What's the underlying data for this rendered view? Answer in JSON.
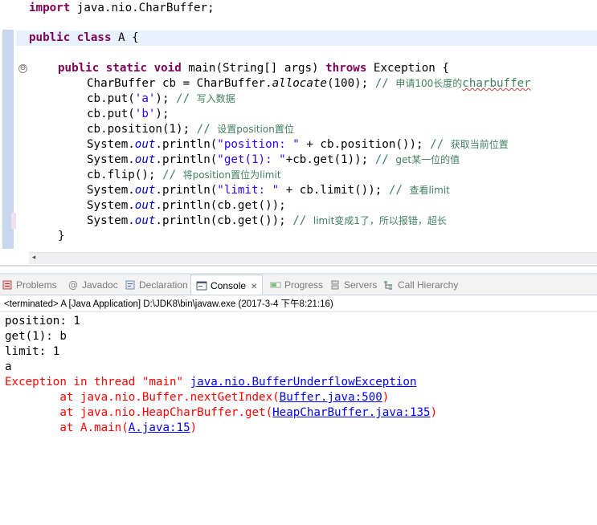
{
  "editor": {
    "line_import_kw": "import",
    "line_import_rest": " java.nio.CharBuffer;",
    "class_kw": "public class",
    "class_rest": " A {",
    "main_kw1": "public static void",
    "main_rest1": " main(String[] args) ",
    "main_kw2": "throws",
    "main_rest2": " Exception {",
    "l1_code": "CharBuffer cb = CharBuffer.",
    "l1_static": "allocate",
    "l1_tail": "(100); ",
    "l1_cm_a": "// ",
    "l1_cm_b": "申请100长度的",
    "l1_cm_c": "charbuffer",
    "l2_code": "cb.put(",
    "l2_str": "'a'",
    "l2_tail": "); ",
    "l2_cm": "// ",
    "l2_cm_cjk": "写入数据",
    "l3_code": "cb.put(",
    "l3_str": "'b'",
    "l3_tail": ");",
    "l4_code": "cb.position(1); ",
    "l4_cm": "// ",
    "l4_cm_cjk": "设置position置位",
    "l5_a": "System.",
    "l5_field": "out",
    "l5_b": ".println(",
    "l5_str": "\"position: \"",
    "l5_c": " + cb.position()); ",
    "l5_cm": "// ",
    "l5_cm_cjk": "获取当前位置",
    "l6_a": "System.",
    "l6_field": "out",
    "l6_b": ".println(",
    "l6_str": "\"get(1): \"",
    "l6_c": "+cb.get(1)); ",
    "l6_cm": "// ",
    "l6_cm_cjk": "get某一位的值",
    "l7_code": "cb.flip(); ",
    "l7_cm": "// ",
    "l7_cm_cjk": "将position置位为limit",
    "l8_a": "System.",
    "l8_field": "out",
    "l8_b": ".println(",
    "l8_str": "\"limit: \"",
    "l8_c": " + cb.limit()); ",
    "l8_cm": "// ",
    "l8_cm_cjk": "查看limit",
    "l9_a": "System.",
    "l9_field": "out",
    "l9_b": ".println(cb.get());",
    "l10_a": "System.",
    "l10_field": "out",
    "l10_b": ".println(cb.get()); ",
    "l10_cm": "// ",
    "l10_cm_cjk": "limit变成1了，所以报错，超长",
    "close_main": "}",
    "fold_symbol": "⊖",
    "scroll_left_symbol": "◂"
  },
  "views": {
    "tabs": [
      {
        "label": "Problems",
        "icon": "problems-icon"
      },
      {
        "label": "Javadoc",
        "icon": "javadoc-icon"
      },
      {
        "label": "Declaration",
        "icon": "declaration-icon"
      },
      {
        "label": "Console",
        "icon": "console-icon",
        "active": true
      },
      {
        "label": "Progress",
        "icon": "progress-icon"
      },
      {
        "label": "Servers",
        "icon": "servers-icon"
      },
      {
        "label": "Call Hierarchy",
        "icon": "call-hierarchy-icon"
      }
    ],
    "close_symbol": "✕"
  },
  "console": {
    "header": "<terminated> A [Java Application] D:\\JDK8\\bin\\javaw.exe (2017-3-4 下午8:21:16)",
    "out1": "position: 1",
    "out2": "get(1): b",
    "out3": "limit: 1",
    "out4": "a",
    "exc_prefix": "Exception in thread \"main\" ",
    "exc_link": "java.nio.BufferUnderflowException",
    "st1_prefix": "        at java.nio.Buffer.nextGetIndex(",
    "st1_link": "Buffer.java:500",
    "st1_suffix": ")",
    "st2_prefix": "        at java.nio.HeapCharBuffer.get(",
    "st2_link": "HeapCharBuffer.java:135",
    "st2_suffix": ")",
    "st3_prefix": "        at A.main(",
    "st3_link": "A.java:15",
    "st3_suffix": ")"
  },
  "colors": {
    "keyword": "#7f0055",
    "string": "#2a00ff",
    "comment": "#3f7f5f",
    "field": "#0000c0",
    "error": "#ff0000",
    "link": "#0000ff"
  }
}
